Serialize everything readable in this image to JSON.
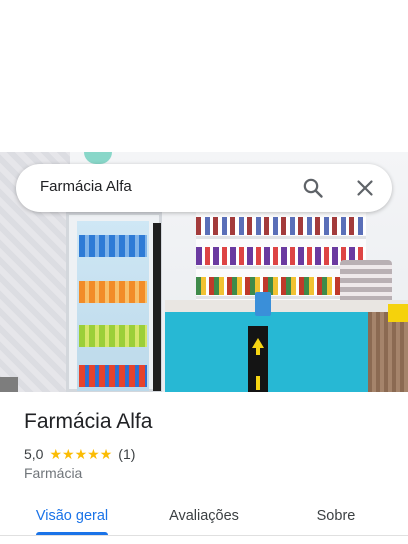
{
  "search": {
    "query": "Farmácia Alfa",
    "search_icon": "search-icon",
    "close_icon": "close-icon"
  },
  "place": {
    "name": "Farmácia Alfa",
    "rating": "5,0",
    "stars": 5,
    "review_count": "(1)",
    "category": "Farmácia"
  },
  "tabs": [
    {
      "label": "Visão geral",
      "active": true
    },
    {
      "label": "Avaliações",
      "active": false
    },
    {
      "label": "Sobre",
      "active": false
    }
  ],
  "colors": {
    "accent": "#1a73e8",
    "star": "#fbbc04",
    "text_primary": "#202124",
    "text_secondary": "#70757a"
  }
}
